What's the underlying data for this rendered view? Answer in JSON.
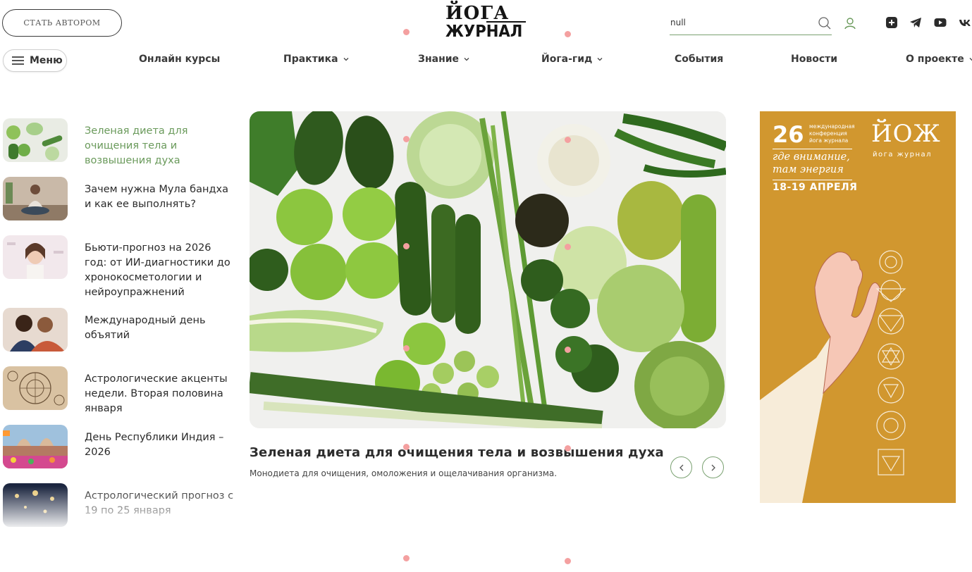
{
  "header": {
    "become_author": "СТАТЬ АВТОРОМ",
    "logo_line1": "ЙОГА",
    "logo_line2": "ЖУРНАЛ",
    "search_value": "null",
    "menu_label": "Меню",
    "social": [
      "plus-icon",
      "telegram-icon",
      "youtube-icon",
      "vk-icon"
    ]
  },
  "nav": [
    {
      "label": "Онлайн курсы",
      "dropdown": false
    },
    {
      "label": "Практика",
      "dropdown": true
    },
    {
      "label": "Знание",
      "dropdown": true
    },
    {
      "label": "Йога-гид",
      "dropdown": true
    },
    {
      "label": "События",
      "dropdown": false
    },
    {
      "label": "Новости",
      "dropdown": false
    },
    {
      "label": "О проекте",
      "dropdown": true
    }
  ],
  "news": [
    {
      "title": "Зеленая диета для очищения тела и возвышения духа",
      "active": true
    },
    {
      "title": "Зачем нужна Мула бандха и как ее выполнять?"
    },
    {
      "title": "Бьюти-прогноз на 2026 год: от ИИ-диагностики до хронокосметологии и нейроупражнений"
    },
    {
      "title": "Международный день объятий"
    },
    {
      "title": "Астрологические акценты недели. Вторая половина января"
    },
    {
      "title": "День Республики Индия – 2026"
    },
    {
      "title": "Астрологический прогноз с 19 по 25 января"
    }
  ],
  "hero": {
    "title": "Зеленая диета для очищения тела и возвышения духа",
    "subtitle": "Монодиета для очищения, омоложения и ощелачивания организма."
  },
  "banner": {
    "number": "26",
    "conference": "международная конференция йога журнала",
    "brand": "ЙОЖ",
    "brand_sub": "йога журнал",
    "slogan_line1": "где внимание,",
    "slogan_line2": "там энергия",
    "dates": "18-19 АПРЕЛЯ"
  },
  "colors": {
    "accent_green": "#6a9a5b",
    "banner_orange": "#d1972f"
  }
}
